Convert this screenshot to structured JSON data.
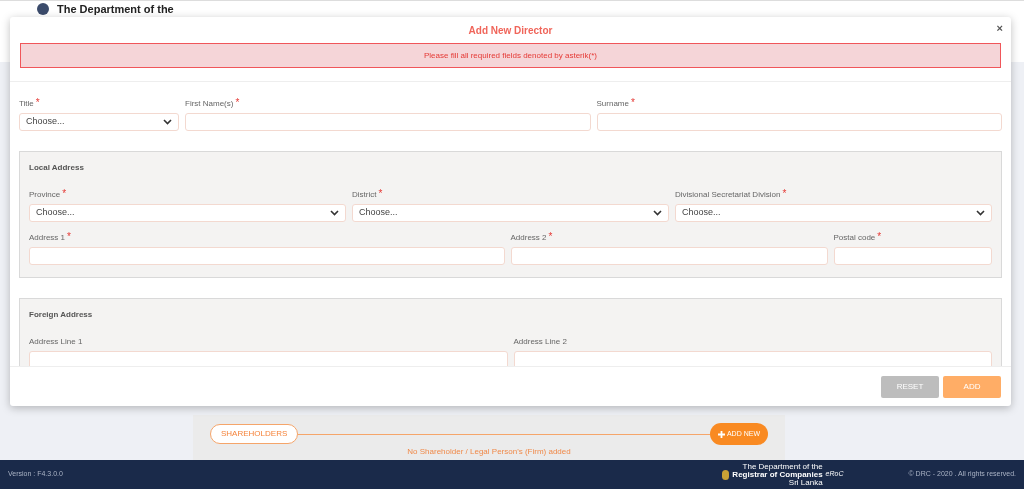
{
  "page_header": {
    "logo_text": "The Department of the"
  },
  "modal": {
    "title": "Add New Director",
    "close": "×",
    "required_mark": "*",
    "alert": "Please fill all required fields denoted by asterik(*)",
    "name_fields": [
      {
        "label": "Title",
        "required": true,
        "kind": "select",
        "value": "Choose..."
      },
      {
        "label": "First Name(s)",
        "required": true,
        "kind": "text"
      },
      {
        "label": "Surname",
        "required": true,
        "kind": "text"
      }
    ],
    "sections": [
      {
        "title": "Local Address",
        "rows": [
          [
            {
              "label": "Province",
              "required": true,
              "kind": "select",
              "value": "Choose..."
            },
            {
              "label": "District",
              "required": true,
              "kind": "select",
              "value": "Choose..."
            },
            {
              "label": "Divisional Secretariat Division",
              "required": true,
              "kind": "select",
              "value": "Choose..."
            }
          ],
          [
            {
              "label": "Address 1",
              "required": true,
              "kind": "text"
            },
            {
              "label": "Address 2",
              "required": true,
              "kind": "text"
            },
            {
              "label": "Postal code",
              "required": true,
              "kind": "text"
            }
          ]
        ]
      },
      {
        "title": "Foreign Address",
        "rows": [
          [
            {
              "label": "Address Line 1",
              "required": false,
              "kind": "text"
            },
            {
              "label": "Address Line 2",
              "required": false,
              "kind": "text"
            }
          ]
        ]
      }
    ],
    "buttons": [
      {
        "label": "RESET",
        "kind": "secondary"
      },
      {
        "label": "ADD",
        "kind": "primary"
      }
    ]
  },
  "shareholders": {
    "label": "SHAREHOLDERS",
    "add_button": "ADD NEW",
    "empty_text": "No Shareholder / Legal Person's (Firm) added"
  },
  "footer": {
    "version": "Version : F4.3.0.0",
    "logo_lines": [
      "The Department of the",
      "Registrar of Companies",
      "Sri Lanka"
    ],
    "eroc": "eRoC",
    "copyright": "© DRC - 2020 . All rights reserved."
  }
}
